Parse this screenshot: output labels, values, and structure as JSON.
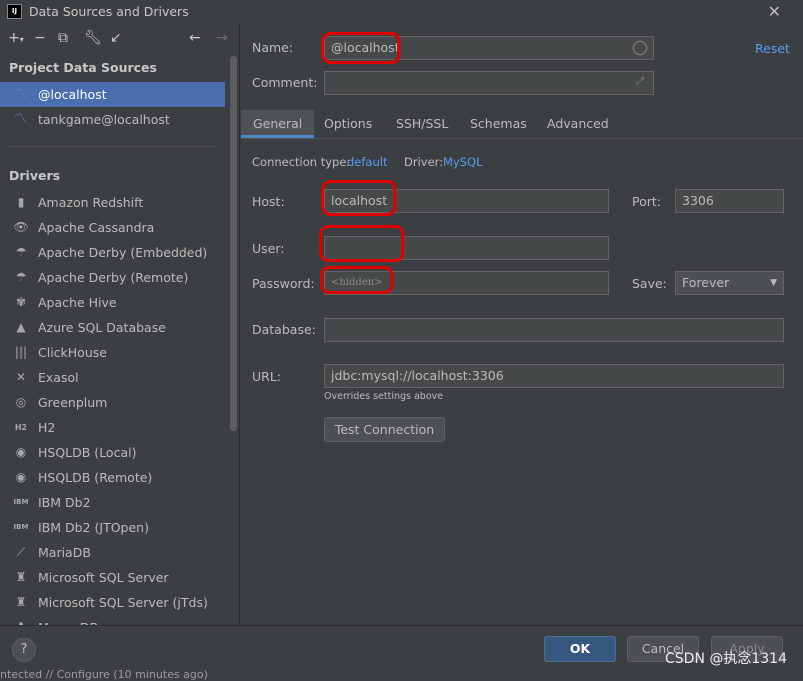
{
  "window": {
    "title": "Data Sources and Drivers",
    "app_icon": "IJ"
  },
  "toolbar": {
    "icons": [
      "add-icon",
      "remove-icon",
      "duplicate-icon",
      "wrench-icon",
      "import-icon",
      "back-arrow-icon",
      "forward-arrow-icon"
    ]
  },
  "project_sources": {
    "heading": "Project Data Sources",
    "items": [
      {
        "label": "@localhost"
      },
      {
        "label": "tankgame@localhost"
      }
    ]
  },
  "drivers": {
    "heading": "Drivers",
    "items": [
      {
        "label": "Amazon Redshift"
      },
      {
        "label": "Apache Cassandra"
      },
      {
        "label": "Apache Derby (Embedded)"
      },
      {
        "label": "Apache Derby (Remote)"
      },
      {
        "label": "Apache Hive"
      },
      {
        "label": "Azure SQL Database"
      },
      {
        "label": "ClickHouse"
      },
      {
        "label": "Exasol"
      },
      {
        "label": "Greenplum"
      },
      {
        "label": "H2"
      },
      {
        "label": "HSQLDB (Local)"
      },
      {
        "label": "HSQLDB (Remote)"
      },
      {
        "label": "IBM Db2"
      },
      {
        "label": "IBM Db2 (JTOpen)"
      },
      {
        "label": "MariaDB"
      },
      {
        "label": "Microsoft SQL Server"
      },
      {
        "label": "Microsoft SQL Server (jTds)"
      },
      {
        "label": "MongoDB"
      }
    ]
  },
  "form": {
    "name_label": "Name:",
    "name_value": "@localhost",
    "reset": "Reset",
    "comment_label": "Comment:",
    "comment_value": "",
    "tabs": [
      "General",
      "Options",
      "SSH/SSL",
      "Schemas",
      "Advanced"
    ],
    "conn_type_label": "Connection type:",
    "conn_type_value": "default",
    "driver_label": "Driver:",
    "driver_value": "MySQL",
    "host_label": "Host:",
    "host_value": "localhost",
    "port_label": "Port:",
    "port_value": "3306",
    "user_label": "User:",
    "user_value": "",
    "password_label": "Password:",
    "password_placeholder": "<hidden>",
    "save_label": "Save:",
    "save_value": "Forever",
    "database_label": "Database:",
    "database_value": "",
    "url_label": "URL:",
    "url_value": "jdbc:mysql://localhost:3306",
    "url_hint": "Overrides settings above",
    "test_connection": "Test Connection"
  },
  "footer": {
    "help": "?",
    "ok": "OK",
    "cancel": "Cancel",
    "apply": "Apply",
    "status": "ntected // Configure (10 minutes ago)",
    "watermark": "CSDN @执念1314"
  },
  "colors": {
    "accent": "#4b6eaf",
    "link": "#589df6",
    "annotation": "#e00000"
  }
}
